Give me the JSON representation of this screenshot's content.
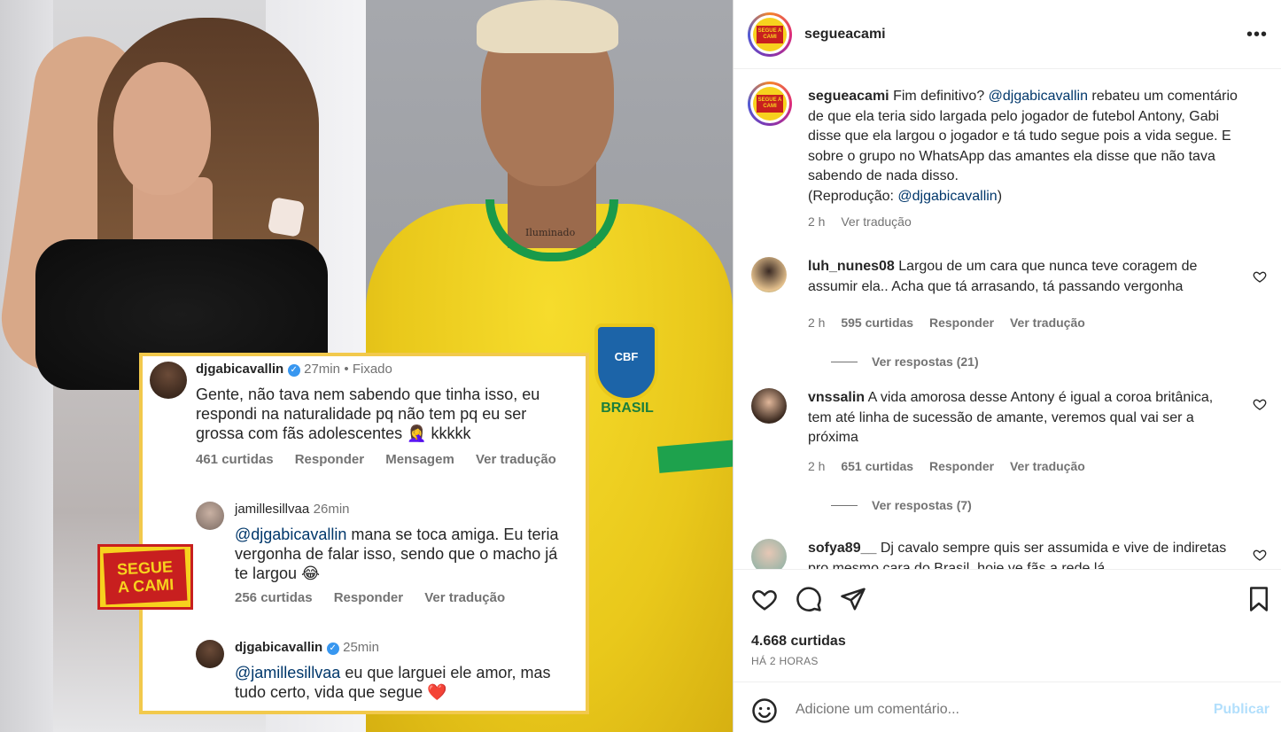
{
  "post": {
    "overlay": {
      "c1": {
        "user": "djgabicavallin",
        "time": "27min",
        "pinned": "• Fixado",
        "text": "Gente, não tava nem sabendo que tinha isso, eu respondi na naturalidade pq não tem pq eu ser grossa com fãs adolescentes 🤦‍♀️ kkkkk",
        "likes": "461 curtidas",
        "reply": "Responder",
        "message": "Mensagem",
        "translate": "Ver tradução"
      },
      "c2": {
        "user": "jamillesillvaa",
        "time": "26min",
        "mention": "@djgabicavallin",
        "text": " mana se toca amiga. Eu teria vergonha de falar isso, sendo que o macho já te largou 😂",
        "likes": "256 curtidas",
        "reply": "Responder",
        "translate": "Ver tradução"
      },
      "c3": {
        "user": "djgabicavallin",
        "time": "25min",
        "mention": "@jamillesillvaa",
        "text": " eu que larguei ele amor, mas tudo certo, vida que segue ❤️"
      },
      "logo_line1": "SEGUE",
      "logo_line2": "A CAMI",
      "tattoo": "Iluminado",
      "crest": "CBF",
      "shirt_text": "BRASIL"
    }
  },
  "header": {
    "username": "segueacami",
    "logo_text": "SEGUE A CAMI",
    "more": "•••"
  },
  "caption": {
    "username": "segueacami",
    "part1": "Fim definitivo? ",
    "mention1": "@djgabicavallin",
    "part2": " rebateu um comentário de que ela teria sido largada pelo jogador de futebol Antony, Gabi disse que ela largou o jogador e tá tudo segue pois a vida segue. E sobre o grupo no WhatsApp das amantes ela disse que não tava sabendo de nada disso.",
    "part3": "(Reprodução: ",
    "mention2": "@djgabicavallin",
    "part4": ")",
    "time": "2 h",
    "translate": "Ver tradução"
  },
  "comments": [
    {
      "user": "luh_nunes08",
      "text": "Largou de um cara que nunca teve coragem de assumir ela.. Acha que tá arrasando, tá passando vergonha",
      "time": "2 h",
      "likes": "595 curtidas",
      "reply": "Responder",
      "translate": "Ver tradução",
      "replies": "Ver respostas (21)"
    },
    {
      "user": "vnssalin",
      "text": "A vida amorosa desse Antony é igual a coroa britânica, tem até linha de sucessão de amante, veremos qual vai ser a próxima",
      "time": "2 h",
      "likes": "651 curtidas",
      "reply": "Responder",
      "translate": "Ver tradução",
      "replies": "Ver respostas (7)"
    },
    {
      "user": "sofya89__",
      "text": "Dj cavalo sempre quis ser assumida e vive de indiretas pro mesmo cara do Brasil, hoje ve fãs a rede lá"
    }
  ],
  "actions": {
    "likes": "4.668 curtidas",
    "posted": "HÁ 2 HORAS"
  },
  "composer": {
    "placeholder": "Adicione um comentário...",
    "publish": "Publicar"
  },
  "colors": {
    "brand_yellow": "#f7d21e",
    "brand_red": "#c81f1f",
    "mention": "#00376b",
    "secondary": "#737373",
    "publish_disabled": "#b2dffc"
  }
}
